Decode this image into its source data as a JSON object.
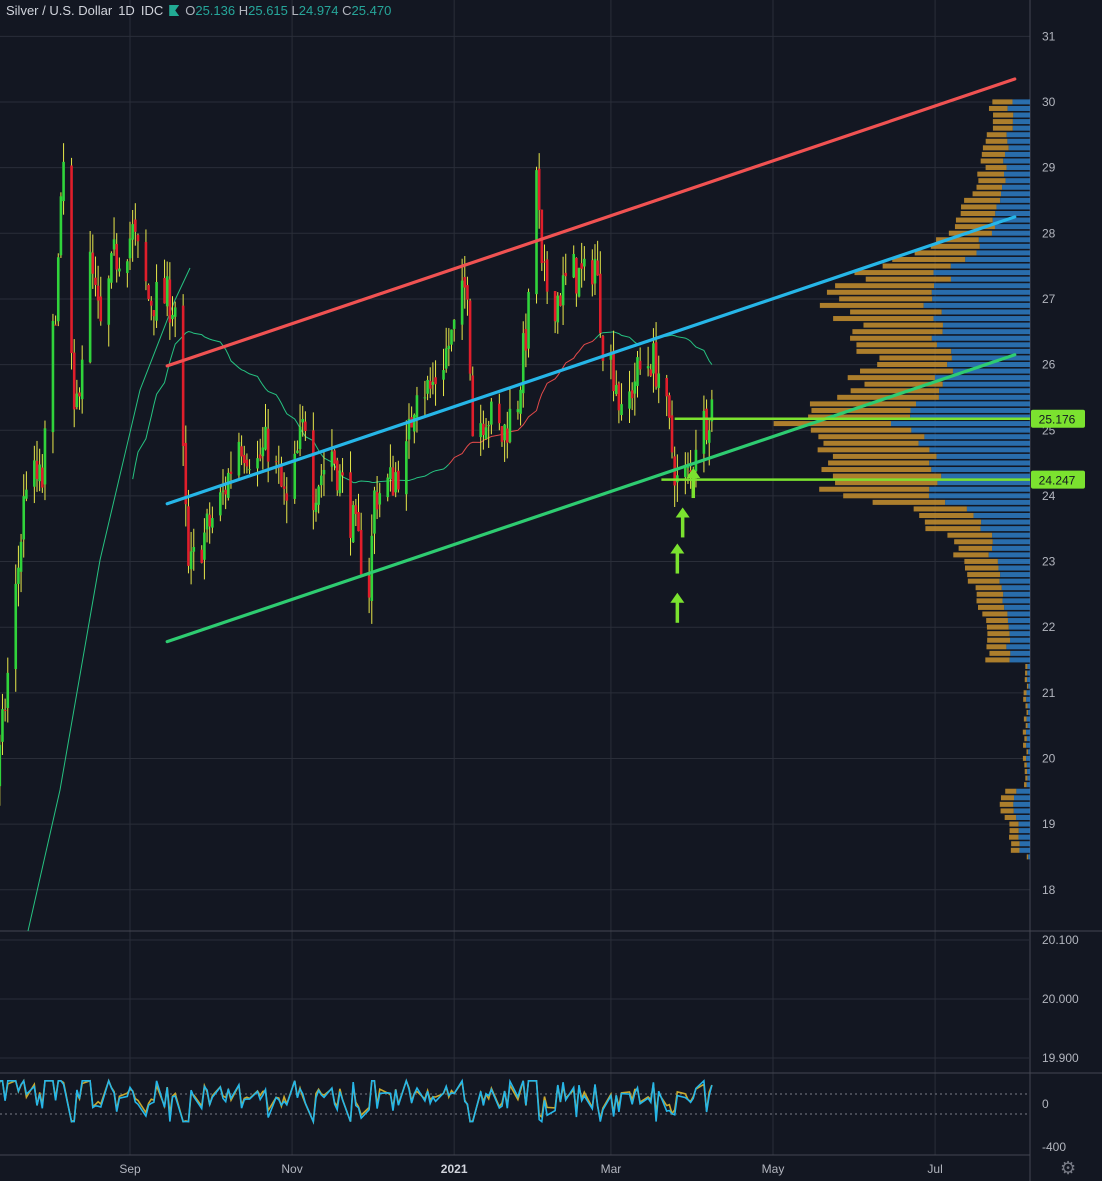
{
  "header": {
    "symbol": "Silver / U.S. Dollar",
    "interval": "1D",
    "source": "IDC",
    "open_label": "O",
    "open": "25.136",
    "high_label": "H",
    "high": "25.615",
    "low_label": "L",
    "low": "24.974",
    "close_label": "C",
    "close": "25.470"
  },
  "colors": {
    "background": "#131722",
    "up": "#30d33b",
    "down": "#e01e2b",
    "wick": "#e8e84a",
    "resistance": "#f05252",
    "midline": "#26b6e8",
    "support": "#2ecc71",
    "level": "#7be22f",
    "vp_up": "#2e7cc4",
    "vp_down": "#c8902e"
  },
  "chart_data": {
    "type": "candlestick",
    "x_tick_labels": [
      "Sep",
      "Nov",
      "2021",
      "Mar",
      "May",
      "Jul"
    ],
    "y_tick_labels": [
      "18",
      "19",
      "20",
      "21",
      "22",
      "23",
      "24",
      "25",
      "26",
      "27",
      "28",
      "29",
      "30",
      "31"
    ],
    "price_labels": [
      "25.176",
      "24.247"
    ],
    "middle_pane_ticks": [
      "20.100",
      "20.000",
      "19.900"
    ],
    "oscillator_ticks": [
      "0",
      "-400"
    ],
    "ylim": [
      17.4,
      31.5
    ],
    "trendlines": [
      {
        "name": "resistance",
        "from": [
          "2020-09-15",
          25.98
        ],
        "to": [
          "2021-07-31",
          30.35
        ]
      },
      {
        "name": "midline",
        "from": [
          "2020-09-15",
          23.88
        ],
        "to": [
          "2021-07-31",
          28.25
        ]
      },
      {
        "name": "support",
        "from": [
          "2020-09-15",
          21.78
        ],
        "to": [
          "2021-07-31",
          26.15
        ]
      }
    ],
    "levels": [
      {
        "value": 25.176,
        "from": "2021-03-25"
      },
      {
        "value": 24.247,
        "from": "2021-03-20"
      }
    ],
    "arrows": [
      {
        "date": "2021-03-26",
        "y": 22.25
      },
      {
        "date": "2021-03-26",
        "y": 23.0
      },
      {
        "date": "2021-03-28",
        "y": 23.55
      },
      {
        "date": "2021-04-01",
        "y": 24.15
      }
    ],
    "waypoints": [
      [
        "2020-07-01",
        18.7
      ],
      [
        "2020-07-07",
        19.3
      ],
      [
        "2020-07-13",
        19.6
      ],
      [
        "2020-07-20",
        22.5
      ],
      [
        "2020-07-24",
        24.3
      ],
      [
        "2020-07-30",
        24.2
      ],
      [
        "2020-08-05",
        27.5
      ],
      [
        "2020-08-07",
        29.0
      ],
      [
        "2020-08-11",
        25.0
      ],
      [
        "2020-08-17",
        27.5
      ],
      [
        "2020-08-21",
        26.5
      ],
      [
        "2020-08-26",
        27.6
      ],
      [
        "2020-09-02",
        28.0
      ],
      [
        "2020-09-08",
        27.0
      ],
      [
        "2020-09-15",
        27.0
      ],
      [
        "2020-09-18",
        26.9
      ],
      [
        "2020-09-21",
        24.5
      ],
      [
        "2020-09-23",
        22.8
      ],
      [
        "2020-09-28",
        23.3
      ],
      [
        "2020-10-06",
        24.0
      ],
      [
        "2020-10-12",
        24.9
      ],
      [
        "2020-10-19",
        24.5
      ],
      [
        "2020-10-23",
        24.8
      ],
      [
        "2020-10-30",
        23.8
      ],
      [
        "2020-11-06",
        25.2
      ],
      [
        "2020-11-09",
        24.1
      ],
      [
        "2020-11-16",
        24.7
      ],
      [
        "2020-11-23",
        23.7
      ],
      [
        "2020-11-30",
        22.6
      ],
      [
        "2020-12-02",
        24.0
      ],
      [
        "2020-12-08",
        24.2
      ],
      [
        "2020-12-14",
        24.6
      ],
      [
        "2020-12-18",
        25.8
      ],
      [
        "2020-12-23",
        25.6
      ],
      [
        "2021-01-01",
        26.5
      ],
      [
        "2021-01-06",
        27.3
      ],
      [
        "2021-01-08",
        25.0
      ],
      [
        "2021-01-13",
        25.3
      ],
      [
        "2021-01-19",
        24.9
      ],
      [
        "2021-01-25",
        25.5
      ],
      [
        "2021-01-29",
        26.8
      ],
      [
        "2021-02-01",
        29.0
      ],
      [
        "2021-02-03",
        27.3
      ],
      [
        "2021-02-08",
        27.0
      ],
      [
        "2021-02-15",
        27.4
      ],
      [
        "2021-02-19",
        27.3
      ],
      [
        "2021-02-23",
        27.6
      ],
      [
        "2021-02-26",
        26.4
      ],
      [
        "2021-03-03",
        25.8
      ],
      [
        "2021-03-05",
        25.1
      ],
      [
        "2021-03-10",
        25.8
      ],
      [
        "2021-03-16",
        26.1
      ],
      [
        "2021-03-19",
        25.9
      ],
      [
        "2021-03-22",
        25.2
      ],
      [
        "2021-03-26",
        24.2
      ],
      [
        "2021-03-31",
        24.3
      ],
      [
        "2021-04-02",
        24.9
      ],
      [
        "2021-04-06",
        25.2
      ],
      [
        "2021-04-08",
        25.47
      ]
    ]
  }
}
